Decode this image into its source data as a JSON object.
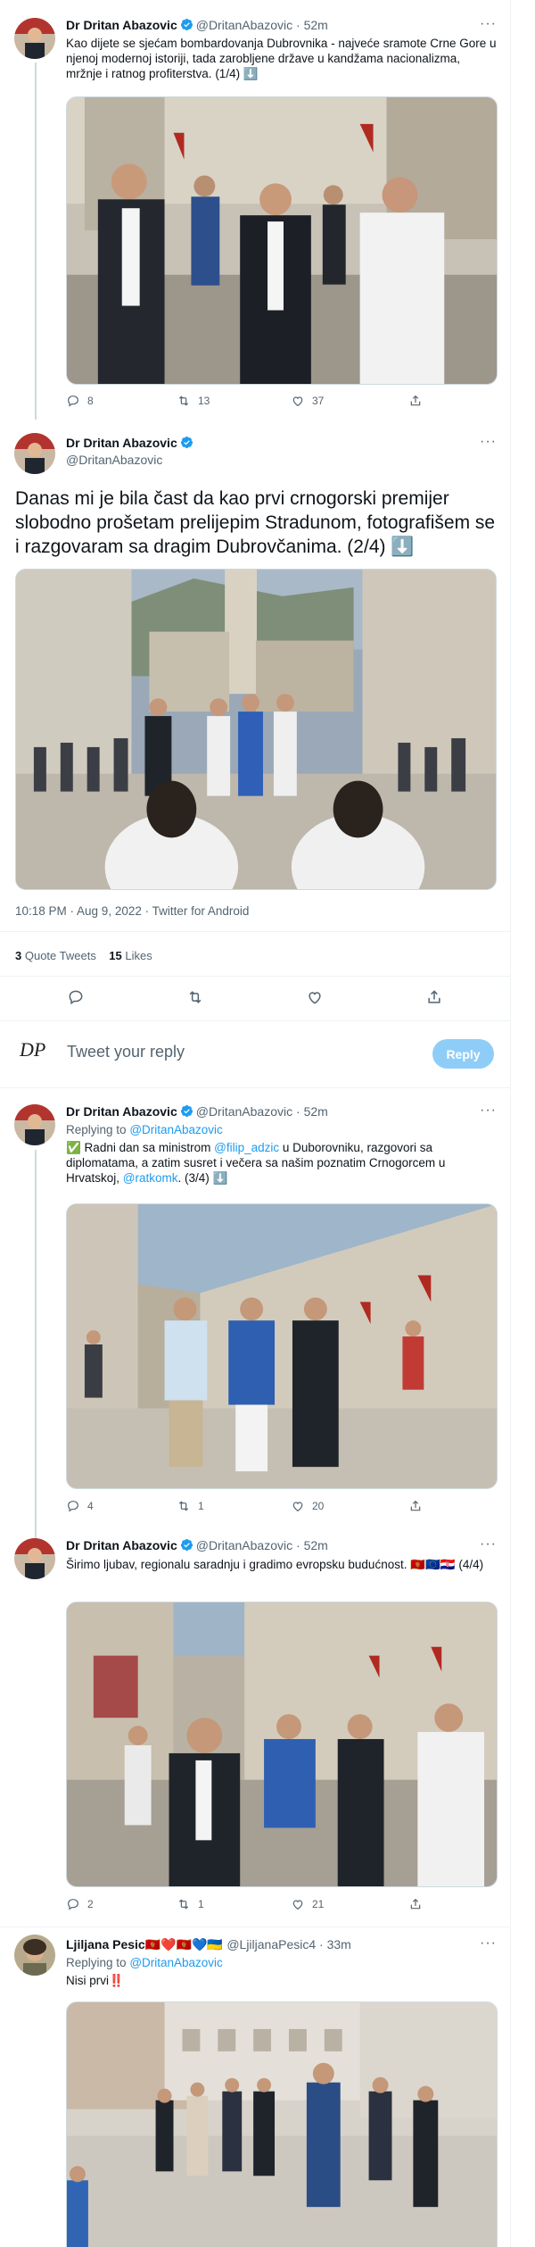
{
  "tweets": [
    {
      "name": "Dr Dritan Abazovic",
      "handle": "@DritanAbazovic",
      "time": "52m",
      "text": "Kao dijete se sjećam bombardovanja Dubrovnika - najveće sramote Crne Gore u njenoj modernoj istoriji, tada zarobljene države u kandžama nacionalizma, mržnje i ratnog profiterstva. (1/4) ⬇️",
      "replies": "8",
      "retweets": "13",
      "likes": "37"
    },
    {
      "name": "Dr Dritan Abazovic",
      "handle": "@DritanAbazovic",
      "text": "Danas mi je bila čast da kao prvi crnogorski premijer slobodno prošetam prelijepim Stradunom, fotografišem se i razgovaram sa dragim Dubrovčanima. (2/4) ⬇️",
      "meta": "10:18 PM · Aug 9, 2022 · Twitter for Android",
      "quote_count": "3",
      "quote_label": "Quote Tweets",
      "like_count": "15",
      "like_label": "Likes"
    },
    {
      "name": "Dr Dritan Abazovic",
      "handle": "@DritanAbazovic",
      "time": "52m",
      "replying_label": "Replying to",
      "replying_to": "@DritanAbazovic",
      "text_prefix": "✅ Radni dan sa ministrom",
      "mention1": "@filip_adzic",
      "text_mid": "u Duborovniku, razgovori sa diplomatama, a zatim susret i večera sa našim poznatim Crnogorcem u Hrvatskoj,",
      "mention2": "@ratkomk",
      "text_suffix": ". (3/4) ⬇️",
      "replies": "4",
      "retweets": "1",
      "likes": "20"
    },
    {
      "name": "Dr Dritan Abazovic",
      "handle": "@DritanAbazovic",
      "time": "52m",
      "text": "Širimo ljubav, regionalu saradnju i gradimo evropsku budućnost. 🇲🇪🇪🇺🇭🇷 (4/4)",
      "replies": "2",
      "retweets": "1",
      "likes": "21"
    },
    {
      "name": "Ljiljana Pesic🇲🇪❤️🇲🇪💙🇺🇦",
      "handle": "@LjiljanaPesic4",
      "time": "33m",
      "replying_label": "Replying to",
      "replying_to": "@DritanAbazovic",
      "text": "Nisi prvi‼️"
    }
  ],
  "reply_box": {
    "logo_text": "DP",
    "placeholder": "Tweet your reply",
    "button": "Reply"
  },
  "icons": [
    "verified-badge-icon",
    "more-icon",
    "reply-icon",
    "retweet-icon",
    "like-icon",
    "share-icon"
  ],
  "colors": {
    "accent": "#1d9bf0",
    "muted": "#536471",
    "reply_button": "#8ecdf8"
  }
}
